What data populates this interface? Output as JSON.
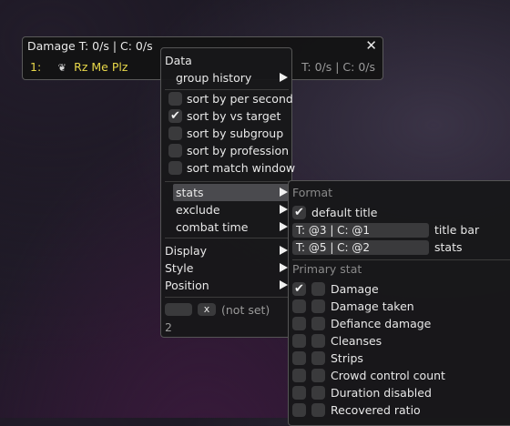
{
  "window": {
    "title": "Damage T: 0/s | C: 0/s",
    "close": "✕",
    "row": {
      "index": "1:",
      "name": "Rz Me Plz",
      "profession_icon": "profession-icon",
      "stats": "T: 0/s | C: 0/s"
    }
  },
  "menu": {
    "data_header": "Data",
    "group_history": "group history",
    "sort_items": [
      {
        "label": "sort by per second",
        "checked": false
      },
      {
        "label": "sort by vs target",
        "checked": true
      },
      {
        "label": "sort by subgroup",
        "checked": false
      },
      {
        "label": "sort by profession",
        "checked": false
      },
      {
        "label": "sort match window",
        "checked": false
      }
    ],
    "stats": "stats",
    "exclude": "exclude",
    "combat_time": "combat time",
    "display": "Display",
    "style": "Style",
    "position": "Position",
    "hotkey_clear": "x",
    "hotkey_value": "(not set)",
    "id": "2"
  },
  "submenu": {
    "format_header": "Format",
    "default_title": "default title",
    "default_title_checked": true,
    "title_bar_value": "T: @3 | C: @1",
    "title_bar_label": "title bar",
    "stats_value": "T: @5 | C: @2",
    "stats_label": "stats",
    "primary_header": "Primary stat",
    "stats_list": [
      {
        "label": "Damage",
        "checked": true
      },
      {
        "label": "Damage taken",
        "checked": false
      },
      {
        "label": "Defiance damage",
        "checked": false
      },
      {
        "label": "Cleanses",
        "checked": false
      },
      {
        "label": "Strips",
        "checked": false
      },
      {
        "label": "Crowd control count",
        "checked": false
      },
      {
        "label": "Duration disabled",
        "checked": false
      },
      {
        "label": "Recovered ratio",
        "checked": false
      }
    ]
  }
}
